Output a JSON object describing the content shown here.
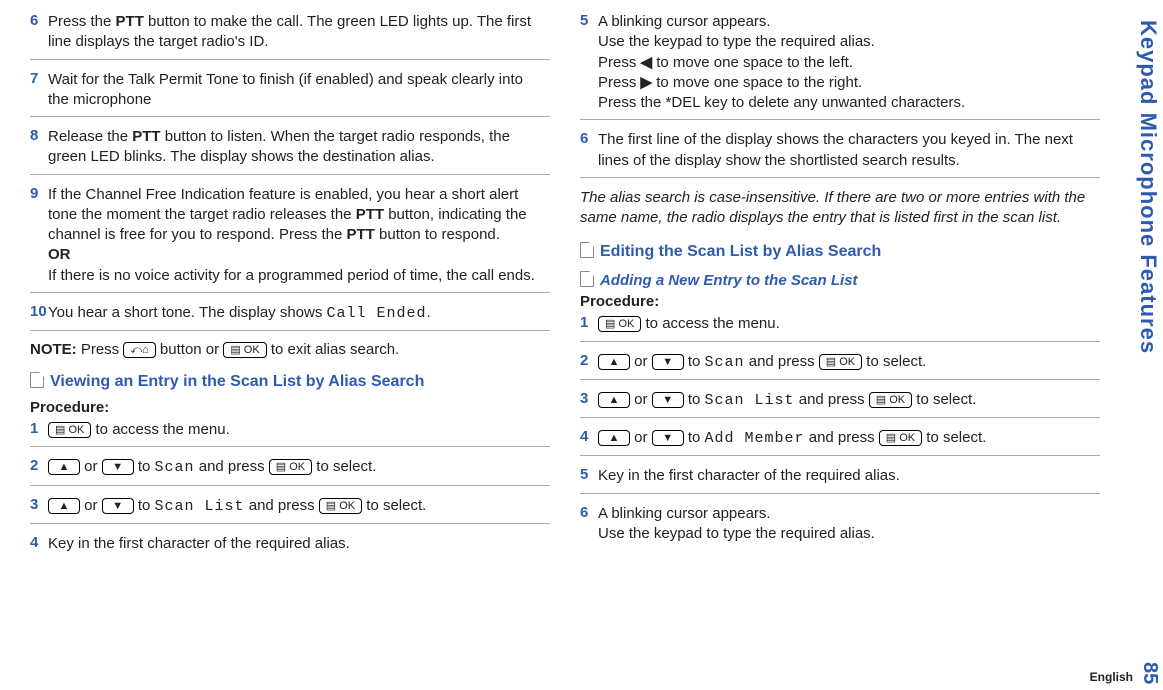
{
  "side_label": "Keypad Microphone Features",
  "page_number": "85",
  "language": "English",
  "left": {
    "step6": "Press the <b>PTT</b> button to make the call. The green LED lights up. The first line displays the target radio's ID.",
    "step7": "Wait for the Talk Permit Tone to finish (if enabled) and speak clearly into the microphone",
    "step8": "Release the <b>PTT</b> button to listen. When the target radio responds, the green LED blinks. The display shows the destination alias.",
    "step9": "If the Channel Free Indication feature is enabled, you hear a short alert tone the moment the target radio releases the <b>PTT</b> button, indicating the channel is free for you to respond. Press the <b>PTT</b> button to respond.<br><b>OR</b><br>If there is no voice activity for a programmed period of time, the call ends.",
    "step10": "You hear a short tone. The display shows <span class=\"lcd\">Call Ended</span>.",
    "note_label": "NOTE:",
    "note_text": "Press <span class=\"btn-icon\" data-name=\"back-home-icon\">⤺⌂</span> button or <span class=\"btn-icon\" data-name=\"ok-icon\">▤ OK</span> to exit alias search.",
    "sec1_title": "Viewing an Entry in the Scan List by Alias Search",
    "proc_label": "Procedure:",
    "s1": "<span class=\"btn-icon\" data-name=\"ok-icon\">▤ OK</span> to access the menu.",
    "s2": "<span class=\"btn-icon\" data-name=\"up-icon\">▲</span> or <span class=\"btn-icon\" data-name=\"down-icon\">▼</span> to <span class=\"lcd\">Scan</span> and press <span class=\"btn-icon\" data-name=\"ok-icon\">▤ OK</span> to select.",
    "s3": "<span class=\"btn-icon\" data-name=\"up-icon\">▲</span> or <span class=\"btn-icon\" data-name=\"down-icon\">▼</span> to <span class=\"lcd\">Scan List</span> and press <span class=\"btn-icon\" data-name=\"ok-icon\">▤ OK</span> to select.",
    "s4": "Key in the first character of the required alias."
  },
  "right": {
    "step5": "A blinking cursor appears.<br>Use the keypad to type the required alias.<br>Press <span class=\"arrow\" data-name=\"left-arrow-icon\">◀</span> to move one space to the left.<br>Press <span class=\"arrow\" data-name=\"right-arrow-icon\">▶</span> to move one space to the right.<br>Press the *DEL key to delete any unwanted characters.",
    "step6": "The first line of the display shows the characters you keyed in. The next lines of the display show the shortlisted search results.",
    "italic_note": "The alias search is case-insensitive. If there are two or more entries with the same name, the radio displays the entry that is listed first in the scan list.",
    "sec2_title": "Editing the Scan List by Alias Search",
    "sub_title": "Adding a New Entry to the Scan List",
    "proc_label": "Procedure:",
    "s1": "<span class=\"btn-icon\" data-name=\"ok-icon\">▤ OK</span> to access the menu.",
    "s2": "<span class=\"btn-icon\" data-name=\"up-icon\">▲</span> or <span class=\"btn-icon\" data-name=\"down-icon\">▼</span> to <span class=\"lcd\">Scan</span> and press <span class=\"btn-icon\" data-name=\"ok-icon\">▤ OK</span> to select.",
    "s3": "<span class=\"btn-icon\" data-name=\"up-icon\">▲</span> or <span class=\"btn-icon\" data-name=\"down-icon\">▼</span> to <span class=\"lcd\">Scan List</span> and press <span class=\"btn-icon\" data-name=\"ok-icon\">▤ OK</span> to select.",
    "s4": "<span class=\"btn-icon\" data-name=\"up-icon\">▲</span> or <span class=\"btn-icon\" data-name=\"down-icon\">▼</span> to <span class=\"lcd\">Add Member</span> and press <span class=\"btn-icon\" data-name=\"ok-icon\">▤ OK</span> to select.",
    "s5": "Key in the first character of the required alias.",
    "s6": "A blinking cursor appears.<br>Use the keypad to type the required alias."
  }
}
